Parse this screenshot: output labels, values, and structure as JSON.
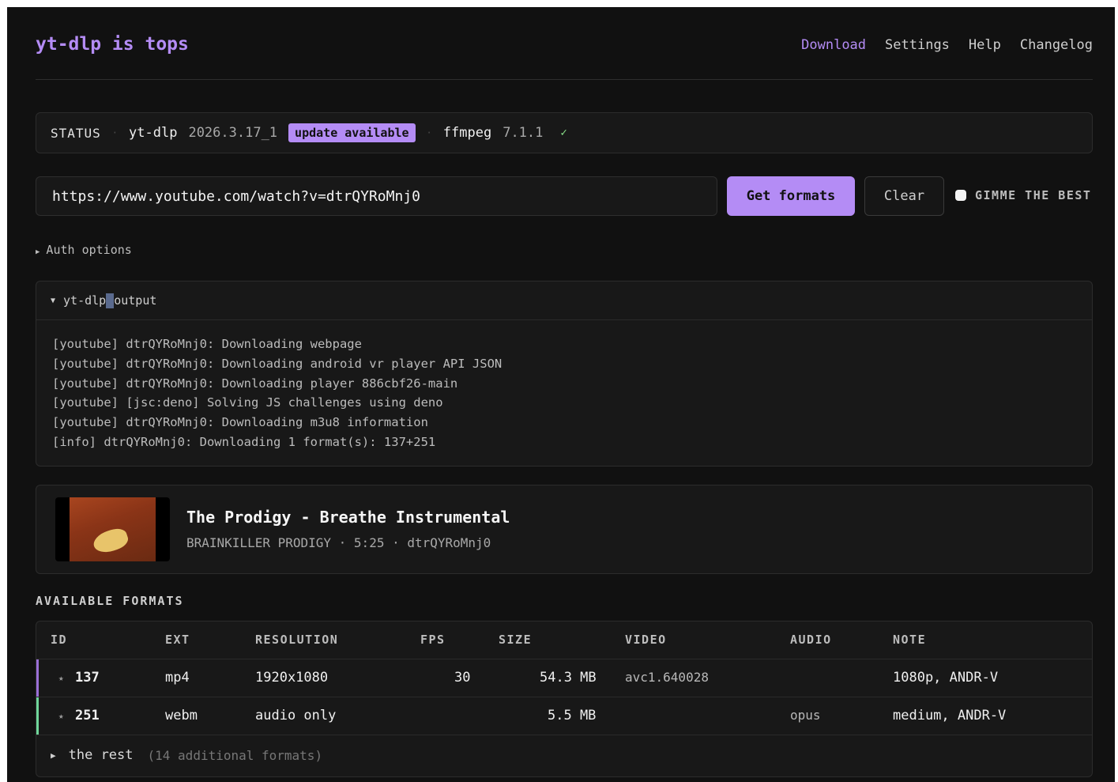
{
  "brand": "yt-dlp is tops",
  "nav": [
    "Download",
    "Settings",
    "Help",
    "Changelog"
  ],
  "status": {
    "label": "STATUS",
    "ytdlp_name": "yt-dlp",
    "ytdlp_version": "2026.3.17_1",
    "update_badge": "update available",
    "ffmpeg_name": "ffmpeg",
    "ffmpeg_version": "7.1.1",
    "check": "✓"
  },
  "url_input": {
    "value": "https://www.youtube.com/watch?v=dtrQYRoMnj0"
  },
  "buttons": {
    "get_formats": "Get formats",
    "clear": "Clear",
    "gimme": "GIMME THE BEST"
  },
  "auth": {
    "label": "Auth options"
  },
  "output": {
    "label_a": "yt-dlp",
    "label_b": "output",
    "lines": [
      "[youtube] dtrQYRoMnj0: Downloading webpage",
      "[youtube] dtrQYRoMnj0: Downloading android vr player API JSON",
      "[youtube] dtrQYRoMnj0: Downloading player 886cbf26-main",
      "[youtube] [jsc:deno] Solving JS challenges using deno",
      "[youtube] dtrQYRoMnj0: Downloading m3u8 information",
      "[info] dtrQYRoMnj0: Downloading 1 format(s): 137+251"
    ]
  },
  "video": {
    "title": "The Prodigy - Breathe Instrumental",
    "meta": "BRAINKILLER PRODIGY · 5:25 · dtrQYRoMnj0"
  },
  "formats": {
    "title": "AVAILABLE FORMATS",
    "columns": [
      "ID",
      "EXT",
      "RESOLUTION",
      "FPS",
      "SIZE",
      "VIDEO",
      "AUDIO",
      "NOTE"
    ],
    "rows": [
      {
        "star": "★",
        "id": "137",
        "ext": "mp4",
        "resolution": "1920x1080",
        "fps": "30",
        "size": "54.3 MB",
        "video": "avc1.640028",
        "audio": "",
        "note": "1080p, ANDR-V",
        "accent": "#9a6fd6"
      },
      {
        "star": "★",
        "id": "251",
        "ext": "webm",
        "resolution": "audio only",
        "fps": "",
        "size": "5.5 MB",
        "video": "",
        "audio": "opus",
        "note": "medium, ANDR-V",
        "accent": "#6fd69a"
      }
    ],
    "rest_label": "the rest",
    "rest_count": "(14 additional formats)"
  }
}
